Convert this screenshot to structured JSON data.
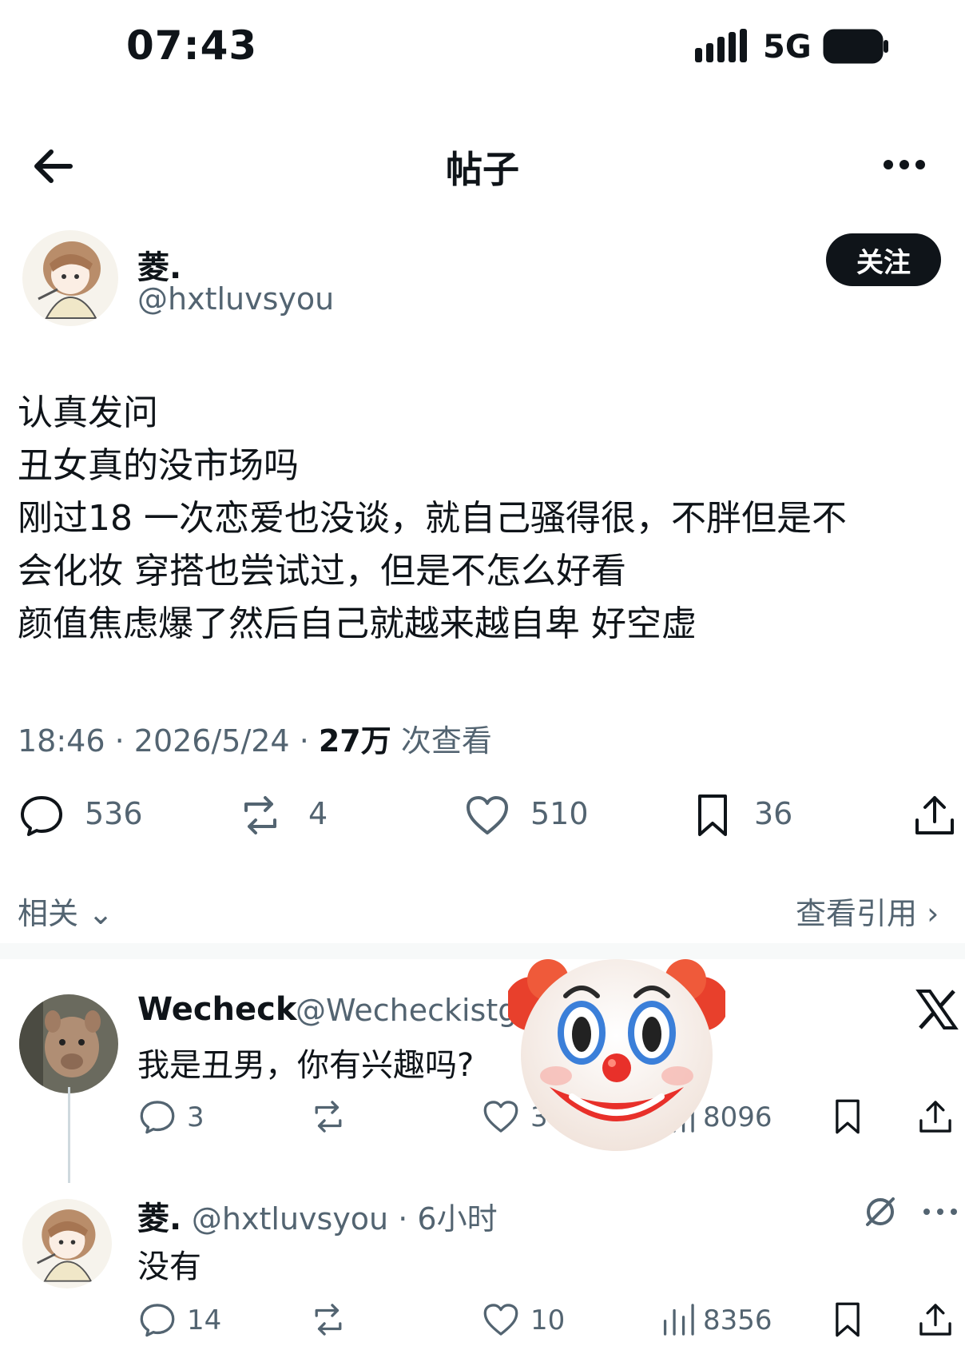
{
  "status_bar": {
    "time": "07:43",
    "network": "5G"
  },
  "header": {
    "title": "帖子"
  },
  "post": {
    "author_name": "菱.",
    "author_handle": "@hxtluvsyou",
    "follow_label": "关注",
    "lines": [
      "认真发问",
      "丑女真的没市场吗",
      "刚过18 一次恋爱也没谈，就自己骚得很，不胖但是不",
      "会化妆 穿搭也尝试过，但是不怎么好看",
      "颜值焦虑爆了然后自己就越来越自卑 好空虚"
    ],
    "time": "18:46",
    "date": "2026/5/24",
    "views": "27万",
    "views_label": "次查看",
    "replies": "536",
    "reposts": "4",
    "likes": "510",
    "bookmarks": "36"
  },
  "related_label": "相关",
  "quotes_label": "查看引用",
  "reply1": {
    "name": "Wecheck",
    "handle": "@Wecheckistg",
    "text": "我是丑男，你有兴趣吗?",
    "replies": "3",
    "likes": "3",
    "views": "8096"
  },
  "reply2": {
    "name": "菱.",
    "handle": "@hxtluvsyou",
    "time": "6小时",
    "text": "没有",
    "replies": "14",
    "likes": "10",
    "views": "8356"
  },
  "icons": {
    "back": "arrow-left-icon",
    "more": "more-icon",
    "reply": "speech-bubble-icon",
    "repost": "repost-icon",
    "like": "heart-icon",
    "bookmark": "bookmark-icon",
    "share": "share-icon",
    "views": "bar-chart-icon",
    "x_logo": "x-logo-icon",
    "clown": "clown-face-icon"
  },
  "colors": {
    "text": "#0f1419",
    "muted": "#536471",
    "follow_bg": "#0f1419"
  }
}
